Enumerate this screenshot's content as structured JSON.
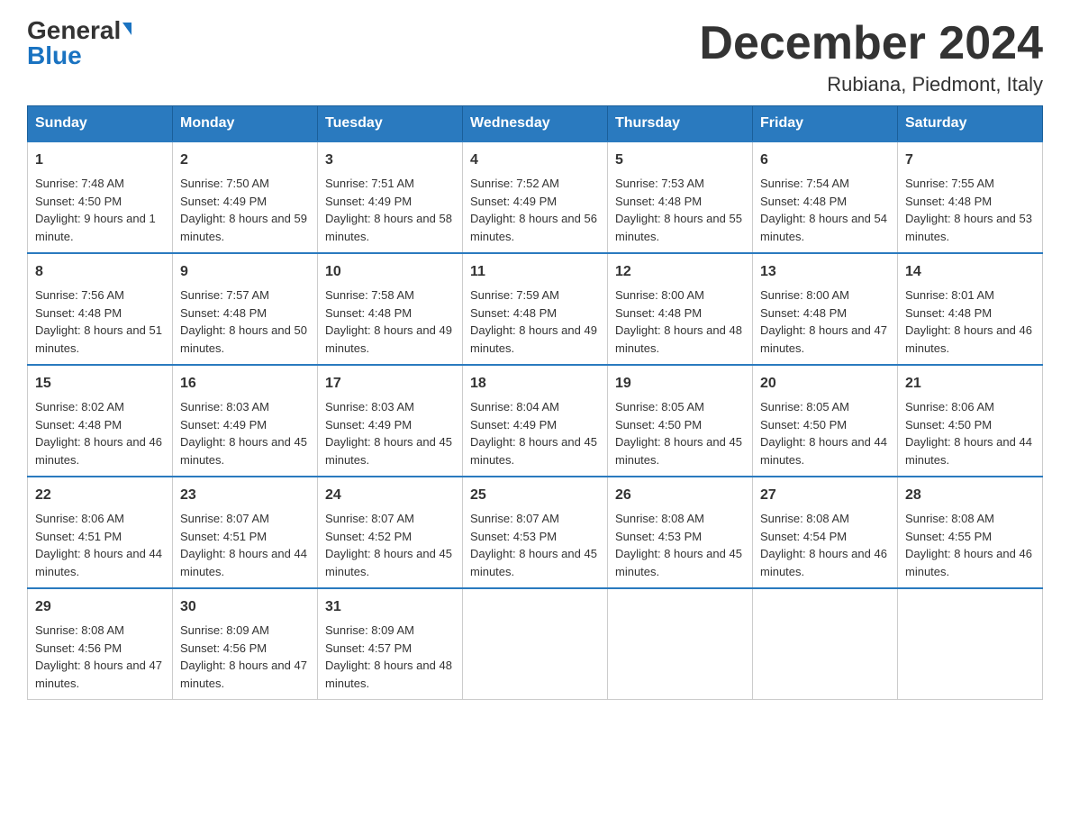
{
  "logo": {
    "general": "General",
    "blue": "Blue"
  },
  "title": "December 2024",
  "subtitle": "Rubiana, Piedmont, Italy",
  "days_of_week": [
    "Sunday",
    "Monday",
    "Tuesday",
    "Wednesday",
    "Thursday",
    "Friday",
    "Saturday"
  ],
  "weeks": [
    [
      {
        "day": "1",
        "sunrise": "7:48 AM",
        "sunset": "4:50 PM",
        "daylight": "9 hours and 1 minute."
      },
      {
        "day": "2",
        "sunrise": "7:50 AM",
        "sunset": "4:49 PM",
        "daylight": "8 hours and 59 minutes."
      },
      {
        "day": "3",
        "sunrise": "7:51 AM",
        "sunset": "4:49 PM",
        "daylight": "8 hours and 58 minutes."
      },
      {
        "day": "4",
        "sunrise": "7:52 AM",
        "sunset": "4:49 PM",
        "daylight": "8 hours and 56 minutes."
      },
      {
        "day": "5",
        "sunrise": "7:53 AM",
        "sunset": "4:48 PM",
        "daylight": "8 hours and 55 minutes."
      },
      {
        "day": "6",
        "sunrise": "7:54 AM",
        "sunset": "4:48 PM",
        "daylight": "8 hours and 54 minutes."
      },
      {
        "day": "7",
        "sunrise": "7:55 AM",
        "sunset": "4:48 PM",
        "daylight": "8 hours and 53 minutes."
      }
    ],
    [
      {
        "day": "8",
        "sunrise": "7:56 AM",
        "sunset": "4:48 PM",
        "daylight": "8 hours and 51 minutes."
      },
      {
        "day": "9",
        "sunrise": "7:57 AM",
        "sunset": "4:48 PM",
        "daylight": "8 hours and 50 minutes."
      },
      {
        "day": "10",
        "sunrise": "7:58 AM",
        "sunset": "4:48 PM",
        "daylight": "8 hours and 49 minutes."
      },
      {
        "day": "11",
        "sunrise": "7:59 AM",
        "sunset": "4:48 PM",
        "daylight": "8 hours and 49 minutes."
      },
      {
        "day": "12",
        "sunrise": "8:00 AM",
        "sunset": "4:48 PM",
        "daylight": "8 hours and 48 minutes."
      },
      {
        "day": "13",
        "sunrise": "8:00 AM",
        "sunset": "4:48 PM",
        "daylight": "8 hours and 47 minutes."
      },
      {
        "day": "14",
        "sunrise": "8:01 AM",
        "sunset": "4:48 PM",
        "daylight": "8 hours and 46 minutes."
      }
    ],
    [
      {
        "day": "15",
        "sunrise": "8:02 AM",
        "sunset": "4:48 PM",
        "daylight": "8 hours and 46 minutes."
      },
      {
        "day": "16",
        "sunrise": "8:03 AM",
        "sunset": "4:49 PM",
        "daylight": "8 hours and 45 minutes."
      },
      {
        "day": "17",
        "sunrise": "8:03 AM",
        "sunset": "4:49 PM",
        "daylight": "8 hours and 45 minutes."
      },
      {
        "day": "18",
        "sunrise": "8:04 AM",
        "sunset": "4:49 PM",
        "daylight": "8 hours and 45 minutes."
      },
      {
        "day": "19",
        "sunrise": "8:05 AM",
        "sunset": "4:50 PM",
        "daylight": "8 hours and 45 minutes."
      },
      {
        "day": "20",
        "sunrise": "8:05 AM",
        "sunset": "4:50 PM",
        "daylight": "8 hours and 44 minutes."
      },
      {
        "day": "21",
        "sunrise": "8:06 AM",
        "sunset": "4:50 PM",
        "daylight": "8 hours and 44 minutes."
      }
    ],
    [
      {
        "day": "22",
        "sunrise": "8:06 AM",
        "sunset": "4:51 PM",
        "daylight": "8 hours and 44 minutes."
      },
      {
        "day": "23",
        "sunrise": "8:07 AM",
        "sunset": "4:51 PM",
        "daylight": "8 hours and 44 minutes."
      },
      {
        "day": "24",
        "sunrise": "8:07 AM",
        "sunset": "4:52 PM",
        "daylight": "8 hours and 45 minutes."
      },
      {
        "day": "25",
        "sunrise": "8:07 AM",
        "sunset": "4:53 PM",
        "daylight": "8 hours and 45 minutes."
      },
      {
        "day": "26",
        "sunrise": "8:08 AM",
        "sunset": "4:53 PM",
        "daylight": "8 hours and 45 minutes."
      },
      {
        "day": "27",
        "sunrise": "8:08 AM",
        "sunset": "4:54 PM",
        "daylight": "8 hours and 46 minutes."
      },
      {
        "day": "28",
        "sunrise": "8:08 AM",
        "sunset": "4:55 PM",
        "daylight": "8 hours and 46 minutes."
      }
    ],
    [
      {
        "day": "29",
        "sunrise": "8:08 AM",
        "sunset": "4:56 PM",
        "daylight": "8 hours and 47 minutes."
      },
      {
        "day": "30",
        "sunrise": "8:09 AM",
        "sunset": "4:56 PM",
        "daylight": "8 hours and 47 minutes."
      },
      {
        "day": "31",
        "sunrise": "8:09 AM",
        "sunset": "4:57 PM",
        "daylight": "8 hours and 48 minutes."
      },
      null,
      null,
      null,
      null
    ]
  ],
  "labels": {
    "sunrise": "Sunrise:",
    "sunset": "Sunset:",
    "daylight": "Daylight:"
  }
}
